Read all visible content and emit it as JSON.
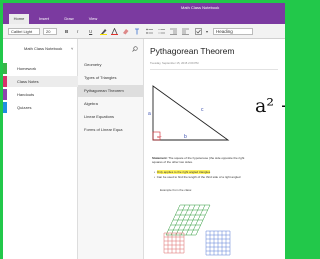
{
  "app": {
    "title": "Math Class Notebook"
  },
  "ribbon": {
    "tabs": [
      "Home",
      "Insert",
      "Draw",
      "View"
    ]
  },
  "toolbar": {
    "font": "Calibri Light",
    "size": "20",
    "bold": "B",
    "italic": "I",
    "underline": "U",
    "styles": "Heading"
  },
  "notebook": {
    "name": "Math Class Notebook",
    "sections": [
      {
        "label": "Homework",
        "color": "#3ab54a"
      },
      {
        "label": "Class Notes",
        "color": "#d6336c"
      },
      {
        "label": "Handouts",
        "color": "#8e44ad"
      },
      {
        "label": "Quizzes",
        "color": "#1f8fe0"
      }
    ],
    "pages": [
      "Geometry",
      "Types of Triangles",
      "Pythagorean Theorem",
      "Algebra",
      "Linear Equations",
      "Forms of Linear Equa"
    ]
  },
  "page": {
    "title": "Pythagorean Theorem",
    "date": "Tuesday, September 15, 2015     2:09 PM",
    "triangle_labels": {
      "c": "c",
      "a": "a",
      "b": "b",
      "angle": "90°"
    },
    "equation": "a² +",
    "statement_label": "Statement:",
    "statement_line1": " The square of the hypotenuse (the side opposite the right",
    "statement_line2": "squares of the other two sides.",
    "bullet1": "Only applies to the right angled triangles",
    "bullet2": "Can be used to find the length of the third side of a right angled",
    "example": "Example from the class:"
  },
  "colors": {
    "accent": "#7b3aa0",
    "background": "#22c84a",
    "highlight": "#fff35c",
    "triangle_labels": "#3a4fb0",
    "right_angle": "#d0202a",
    "grid_red": "#d66",
    "grid_blue": "#5a7fd6",
    "grid_green": "#2e9a3a"
  }
}
